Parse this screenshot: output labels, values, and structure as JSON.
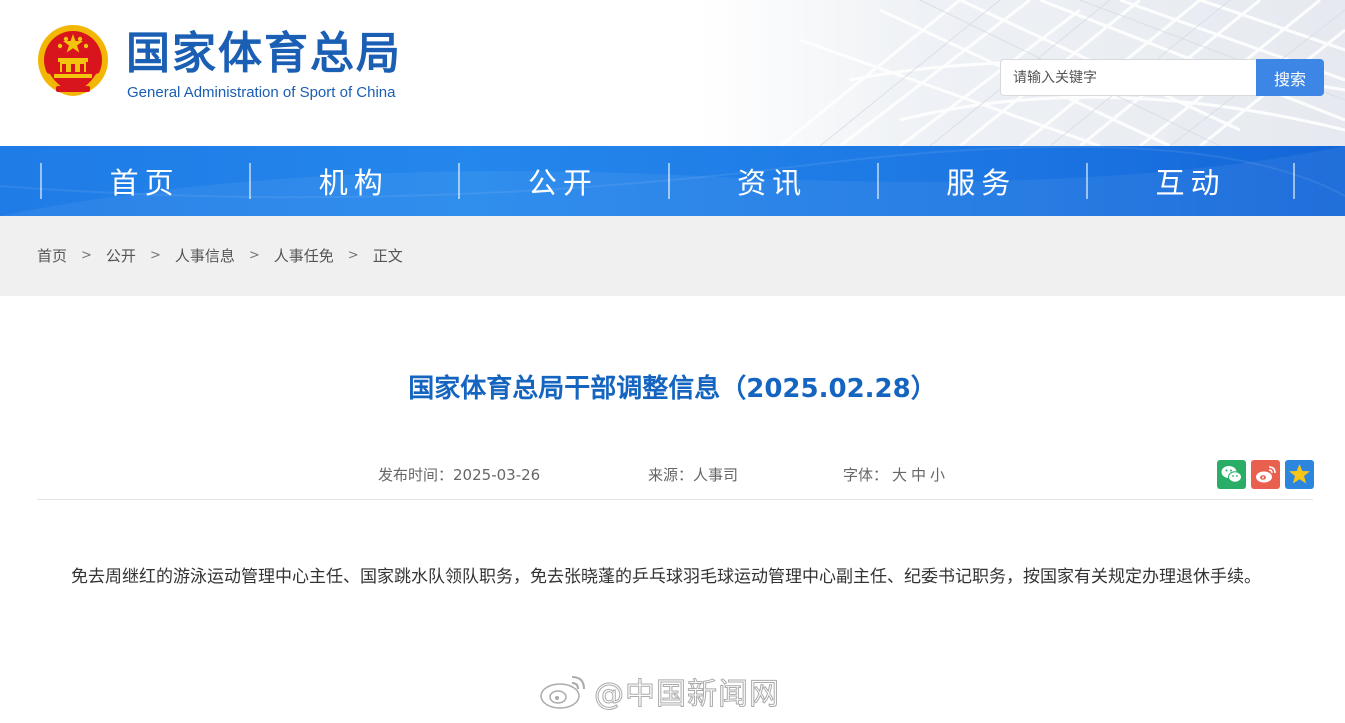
{
  "header": {
    "title_cn": "国家体育总局",
    "title_en": "General Administration of Sport of China",
    "emblem_icon": "national-emblem-icon"
  },
  "search": {
    "placeholder": "请输入关键字",
    "button_label": "搜索"
  },
  "nav": {
    "items": [
      {
        "label": "首页"
      },
      {
        "label": "机构"
      },
      {
        "label": "公开"
      },
      {
        "label": "资讯"
      },
      {
        "label": "服务"
      },
      {
        "label": "互动"
      }
    ]
  },
  "breadcrumb": {
    "items": [
      "首页",
      "公开",
      "人事信息",
      "人事任免",
      "正文"
    ],
    "separator": ">"
  },
  "article": {
    "title": "国家体育总局干部调整信息（2025.02.28）",
    "published_label": "发布时间：",
    "published": "2025-03-26",
    "source_label": "来源：",
    "source": "人事司",
    "font_label": "字体：",
    "font_sizes": [
      "大",
      "中",
      "小"
    ],
    "body": "免去周继红的游泳运动管理中心主任、国家跳水队领队职务，免去张晓蓬的乒乓球羽毛球运动管理中心副主任、纪委书记职务，按国家有关规定办理退休手续。"
  },
  "share": {
    "icons": [
      "wechat-icon",
      "weibo-icon",
      "favorite-star-icon"
    ]
  },
  "watermark": {
    "text": "@中国新闻网",
    "icon": "weibo-logo-icon"
  },
  "colors": {
    "brand_blue": "#1a5fb4",
    "nav_blue": "#1f7be6",
    "title_blue": "#1565c0",
    "search_button": "#3d86e6",
    "breadcrumb_bg": "#f0f0f0",
    "wechat_green": "#2aae67",
    "weibo_red": "#e6162d",
    "star_gold": "#f5c518"
  }
}
